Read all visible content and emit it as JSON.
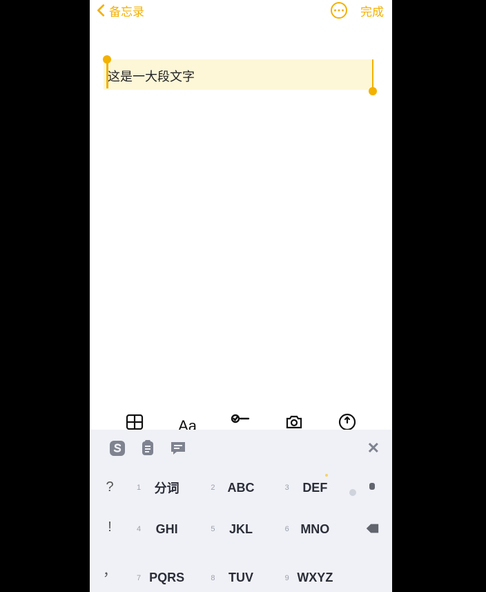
{
  "nav": {
    "back_label": "备忘录",
    "done_label": "完成"
  },
  "note": {
    "selected_text": "这是一大段文字"
  },
  "keyboard": {
    "symbols": [
      "?",
      "!",
      "，"
    ],
    "rows": [
      [
        {
          "n": "1",
          "l": "分词"
        },
        {
          "n": "2",
          "l": "ABC"
        },
        {
          "n": "3",
          "l": "DEF"
        }
      ],
      [
        {
          "n": "4",
          "l": "GHI"
        },
        {
          "n": "5",
          "l": "JKL"
        },
        {
          "n": "6",
          "l": "MNO"
        }
      ],
      [
        {
          "n": "7",
          "l": "PQRS"
        },
        {
          "n": "8",
          "l": "TUV"
        },
        {
          "n": "9",
          "l": "WXYZ"
        }
      ]
    ]
  }
}
